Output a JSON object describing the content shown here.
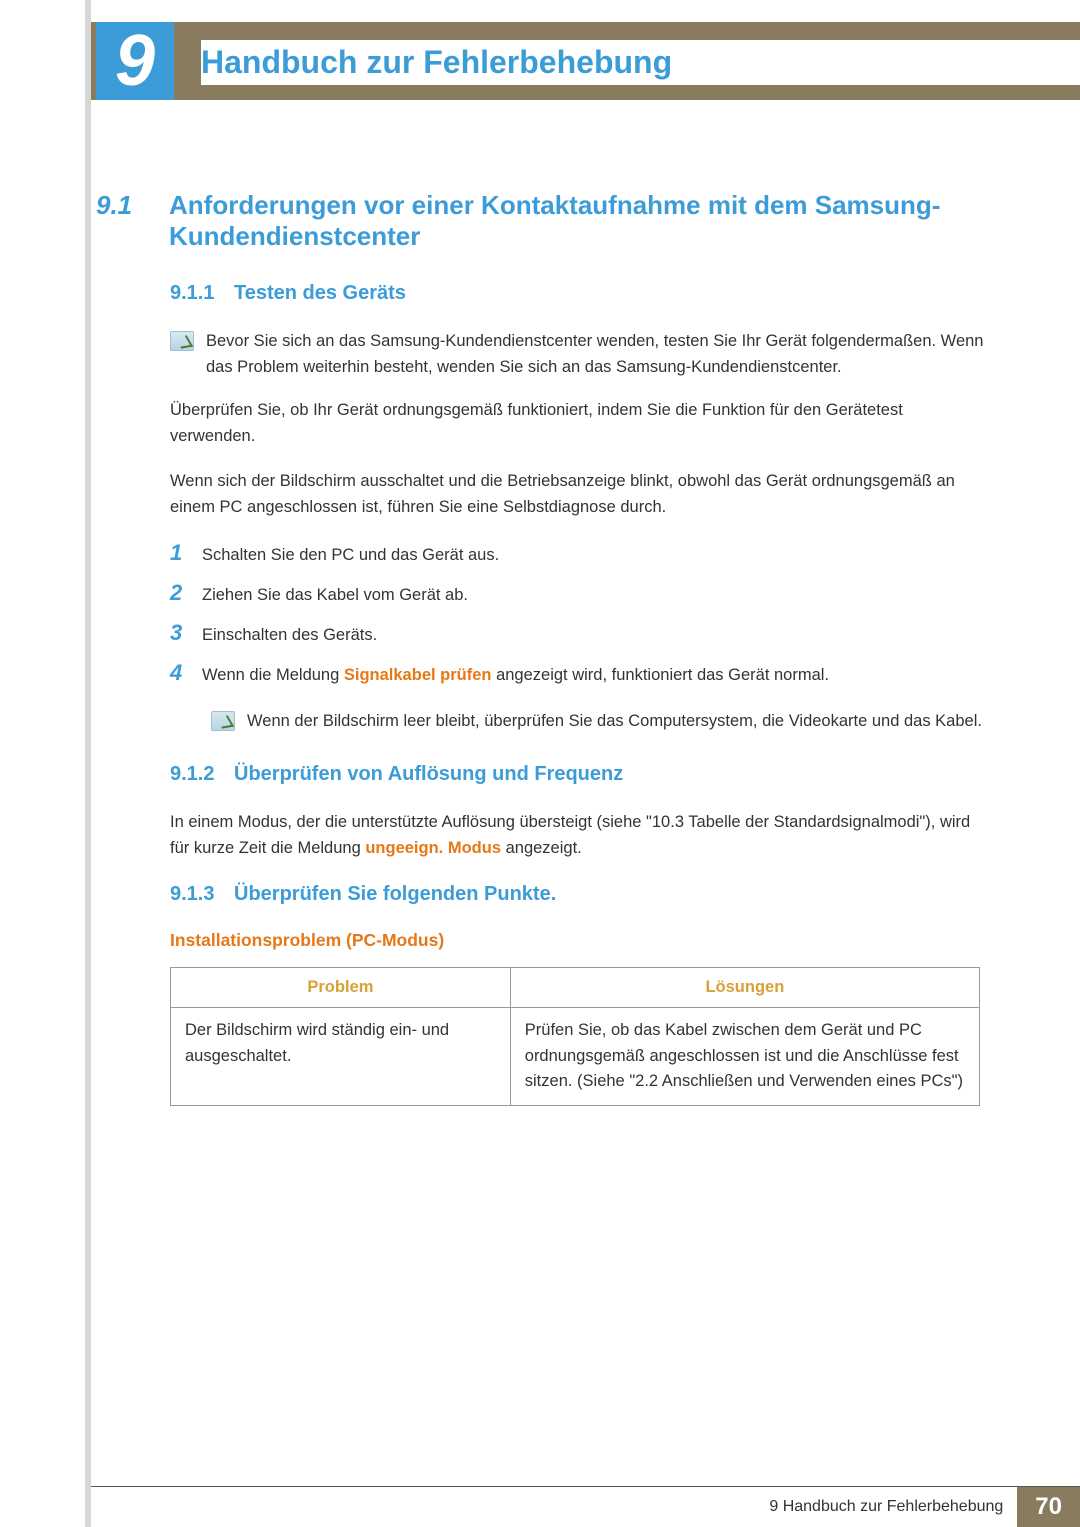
{
  "chapter": {
    "number": "9",
    "title": "Handbuch zur Fehlerbehebung"
  },
  "sec91": {
    "num": "9.1",
    "title": "Anforderungen vor einer Kontaktaufnahme mit dem Samsung-Kundendienstcenter"
  },
  "sub911": {
    "num": "9.1.1",
    "title": "Testen des Geräts",
    "note": "Bevor Sie sich an das Samsung-Kundendienstcenter wenden, testen Sie Ihr Gerät folgendermaßen. Wenn das Problem weiterhin besteht, wenden Sie sich an das Samsung-Kundendienstcenter.",
    "p1": "Überprüfen Sie, ob Ihr Gerät ordnungsgemäß funktioniert, indem Sie die Funktion für den Gerätetest verwenden.",
    "p2": "Wenn sich der Bildschirm ausschaltet und die Betriebsanzeige blinkt, obwohl das Gerät ordnungsgemäß an einem PC angeschlossen ist, führen Sie eine Selbstdiagnose durch.",
    "steps": {
      "s1": "Schalten Sie den PC und das Gerät aus.",
      "s2": "Ziehen Sie das Kabel vom Gerät ab.",
      "s3": "Einschalten des Geräts.",
      "s4_pre": "Wenn die Meldung ",
      "s4_hl": "Signalkabel prüfen",
      "s4_post": " angezeigt wird, funktioniert das Gerät normal."
    },
    "inner_note": "Wenn der Bildschirm leer bleibt, überprüfen Sie das Computersystem, die Videokarte und das Kabel."
  },
  "sub912": {
    "num": "9.1.2",
    "title": "Überprüfen von Auflösung und Frequenz",
    "p_pre": "In einem Modus, der die unterstützte Auflösung übersteigt (siehe \"10.3 Tabelle der Standardsignalmodi\"), wird für kurze Zeit die Meldung ",
    "p_hl": "ungeeign. Modus",
    "p_post": " angezeigt."
  },
  "sub913": {
    "num": "9.1.3",
    "title": "Überprüfen Sie folgenden Punkte.",
    "heading": "Installationsproblem (PC-Modus)",
    "table": {
      "th1": "Problem",
      "th2": "Lösungen",
      "r1c1": "Der Bildschirm wird ständig ein- und ausgeschaltet.",
      "r1c2": "Prüfen Sie, ob das Kabel zwischen dem Gerät und PC ordnungsgemäß angeschlossen ist und die Anschlüsse fest sitzen. (Siehe \"2.2 Anschließen und Verwenden eines PCs\")"
    }
  },
  "footer": {
    "label": "9 Handbuch zur Fehlerbehebung",
    "page": "70"
  }
}
